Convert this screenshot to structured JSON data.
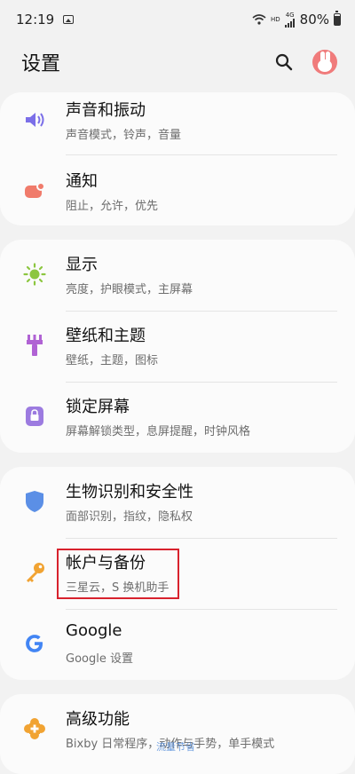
{
  "status": {
    "time": "12:19",
    "net_hd": "HD",
    "net_4g": "4G",
    "battery": "80%"
  },
  "header": {
    "title": "设置"
  },
  "sections": [
    {
      "items": [
        {
          "title": "声音和振动",
          "subtitle": "声音模式，铃声，音量",
          "icon": "speaker-icon",
          "color": "#7b6fe8"
        },
        {
          "title": "通知",
          "subtitle": "阻止，允许，优先",
          "icon": "notification-icon",
          "color": "#f07b6b"
        }
      ]
    },
    {
      "items": [
        {
          "title": "显示",
          "subtitle": "亮度，护眼模式，主屏幕",
          "icon": "brightness-icon",
          "color": "#8cc63f"
        },
        {
          "title": "壁纸和主题",
          "subtitle": "壁纸，主题，图标",
          "icon": "paintbrush-icon",
          "color": "#b062d4"
        },
        {
          "title": "锁定屏幕",
          "subtitle": "屏幕解锁类型，息屏提醒，时钟风格",
          "icon": "lock-icon",
          "color": "#9c7be0"
        }
      ]
    },
    {
      "items": [
        {
          "title": "生物识别和安全性",
          "subtitle": "面部识别，指纹，隐私权",
          "icon": "shield-icon",
          "color": "#5b8fe6"
        },
        {
          "title": "帐户与备份",
          "subtitle": "三星云，S 换机助手",
          "icon": "key-icon",
          "color": "#f1a332"
        },
        {
          "title": "Google",
          "subtitle": "Google 设置",
          "icon": "google-icon",
          "color": "#4285f4"
        }
      ]
    },
    {
      "items": [
        {
          "title": "高级功能",
          "subtitle": "Bixby 日常程序，动作与手势，单手模式",
          "icon": "plus-gear-icon",
          "color": "#f1a332"
        }
      ]
    }
  ],
  "overlay": {
    "float_label": "流量节省"
  }
}
